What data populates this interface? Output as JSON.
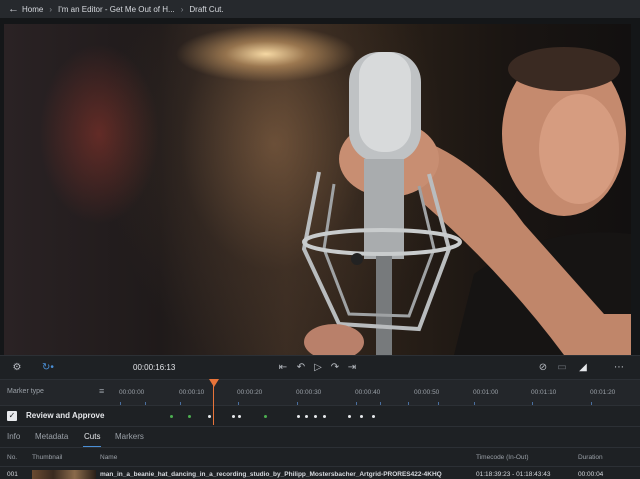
{
  "breadcrumb": {
    "items": [
      "Home",
      "I'm an Editor - Get Me Out of H...",
      "Draft Cut."
    ]
  },
  "transport": {
    "timecode": "00:00:16:13",
    "icons": [
      "settings-icon",
      "loop-icon",
      "go-to-start-icon",
      "step-back-icon",
      "play-icon",
      "step-forward-icon",
      "go-to-end-icon",
      "hide-icon",
      "layers-icon",
      "marker-icon",
      "more-icon"
    ]
  },
  "timeline": {
    "marker_type_label": "Marker type",
    "ticks": [
      "00:00:00",
      "00:00:10",
      "00:00:20",
      "00:00:30",
      "00:00:40",
      "00:00:50",
      "00:01:00",
      "00:01:10",
      "00:01:20"
    ],
    "playhead_color": "#e8743a"
  },
  "review": {
    "label": "Review and Approve",
    "checked": true
  },
  "tabs": [
    {
      "label": "Info",
      "active": false
    },
    {
      "label": "Metadata",
      "active": false
    },
    {
      "label": "Cuts",
      "active": true
    },
    {
      "label": "Markers",
      "active": false
    }
  ],
  "table": {
    "columns": [
      "No.",
      "Thumbnail",
      "Name",
      "Timecode (In-Out)",
      "Duration"
    ],
    "rows": [
      {
        "no": "001",
        "name": "man_in_a_beanie_hat_dancing_in_a_recording_studio_by_Philipp_Mostersbacher_Artgrid-PRORES422-4KHQ",
        "timecode": "01:18:39:23 - 01:18:43:43",
        "duration": "00:00:04"
      }
    ]
  },
  "colors": {
    "accent": "#4a8fd6",
    "playhead": "#e8743a",
    "marker_green": "#4caf50",
    "marker_white": "#e6e8eb"
  }
}
